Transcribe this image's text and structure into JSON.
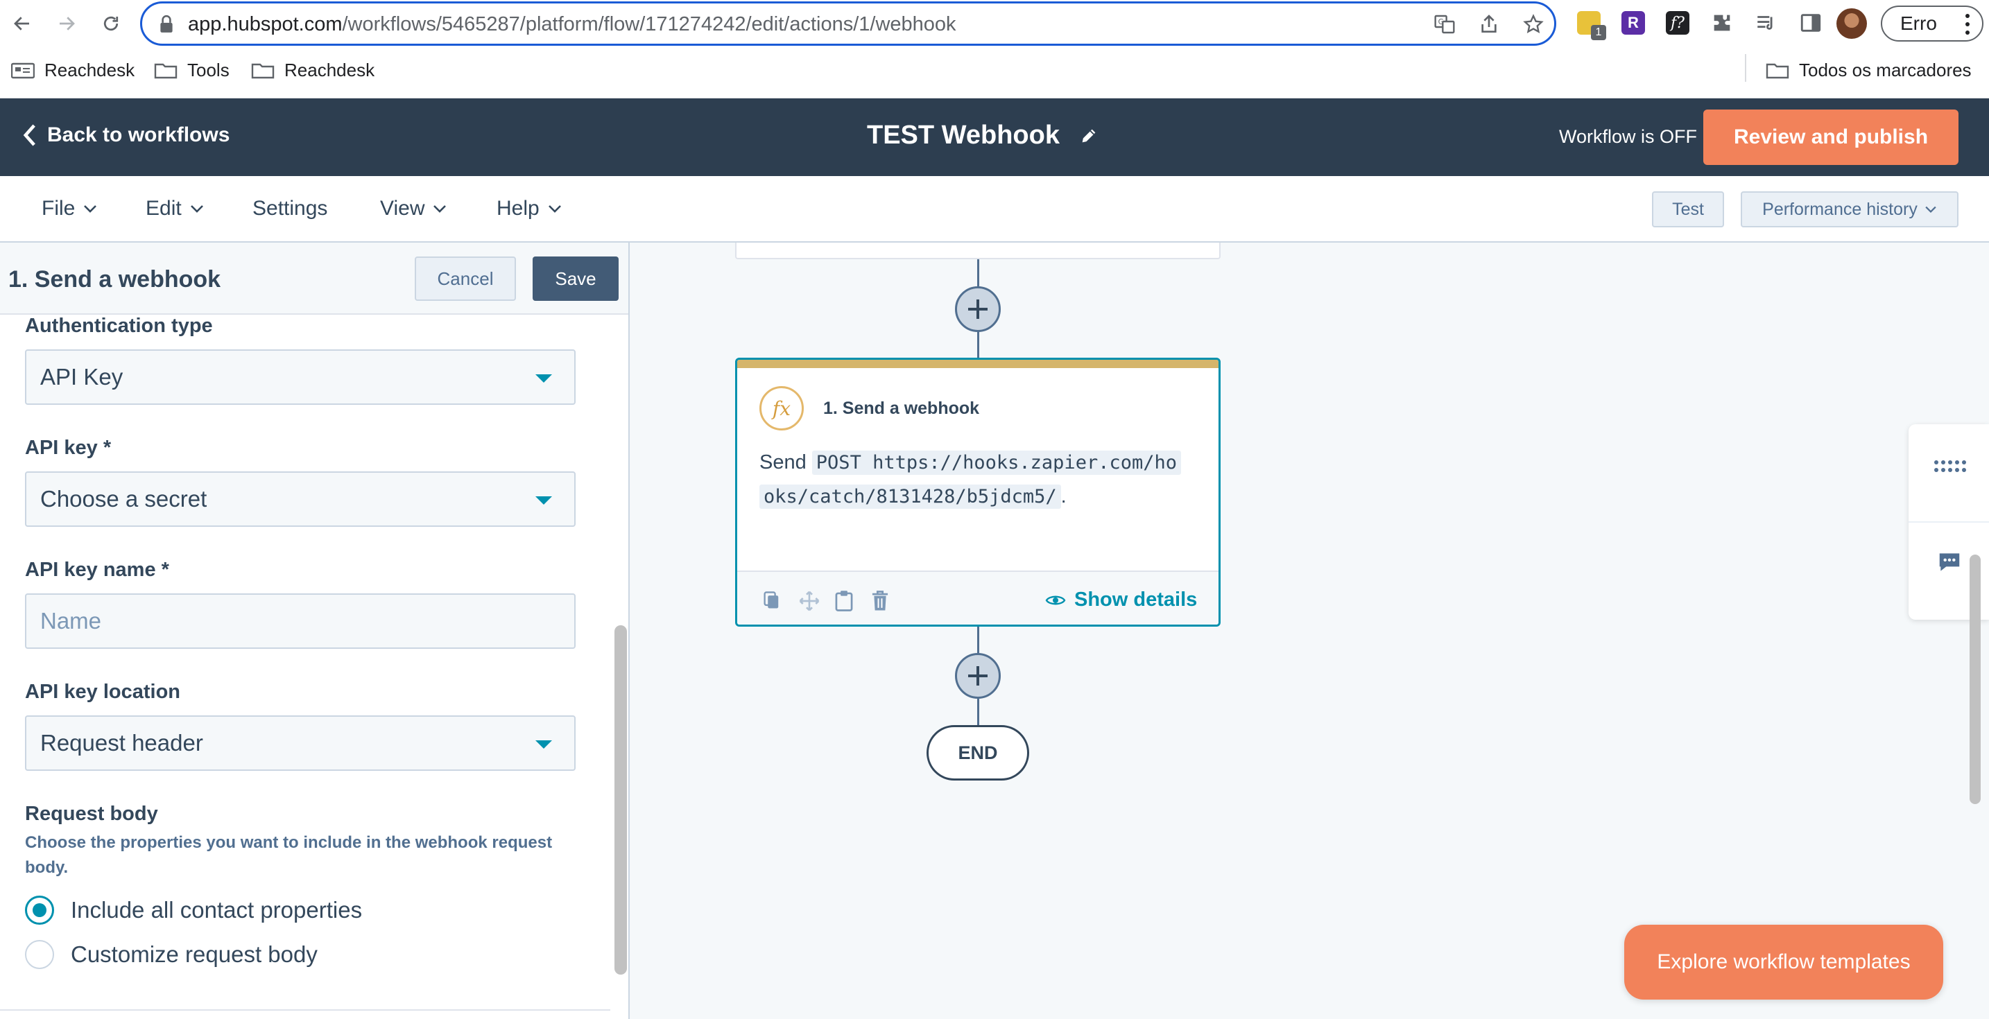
{
  "browser": {
    "url_host": "app.hubspot.com",
    "url_path": "/workflows/5465287/platform/flow/171274242/edit/actions/1/webhook",
    "profile_button": "Erro",
    "extension_badge": "1"
  },
  "bookmarks": {
    "items": [
      {
        "label": "Reachdesk",
        "icon": "reachdesk-icon"
      },
      {
        "label": "Tools",
        "icon": "folder-icon"
      },
      {
        "label": "Reachdesk",
        "icon": "folder-icon"
      }
    ],
    "all_bookmarks": "Todos os marcadores"
  },
  "header": {
    "back_label": "Back to workflows",
    "title": "TEST Webhook",
    "status": "Workflow is OFF",
    "publish_label": "Review and publish",
    "accent": "#f2825a",
    "bg": "#2d3e50"
  },
  "menu": {
    "file": "File",
    "edit": "Edit",
    "settings": "Settings",
    "view": "View",
    "help": "Help",
    "test": "Test",
    "performance": "Performance history"
  },
  "panel": {
    "title": "1. Send a webhook",
    "cancel": "Cancel",
    "save": "Save",
    "auth_type_label": "Authentication type",
    "auth_type_value": "API Key",
    "api_key_label": "API key *",
    "api_key_value": "Choose a secret",
    "api_key_name_label": "API key name *",
    "api_key_name_placeholder": "Name",
    "api_key_location_label": "API key location",
    "api_key_location_value": "Request header",
    "request_body_label": "Request body",
    "request_body_help": "Choose the properties you want to include in the webhook request body.",
    "radio_all": "Include all contact properties",
    "radio_custom": "Customize request body",
    "selected_option": "Include all contact properties"
  },
  "canvas": {
    "card_title": "1. Send a webhook",
    "card_icon_text": "fx",
    "send_word": "Send",
    "method": "POST",
    "url_line1": "https://hooks.zapier.com/ho",
    "url_line2": "oks/catch/8131428/b5jdcm5/",
    "period": ".",
    "show_details": "Show details",
    "end_label": "END",
    "explore_templates": "Explore workflow templates"
  }
}
